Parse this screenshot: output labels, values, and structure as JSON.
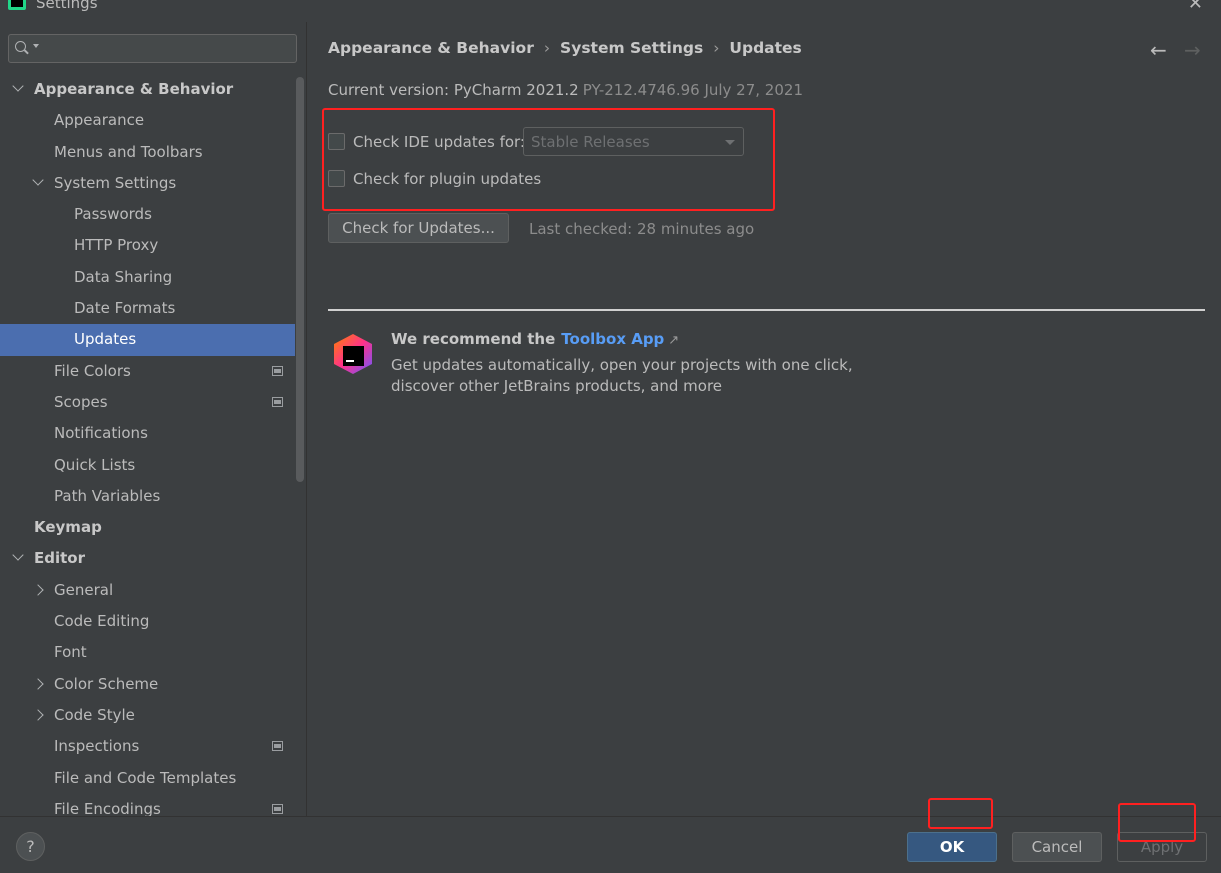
{
  "window": {
    "title": "Settings",
    "close_glyph": "✕"
  },
  "sidebar": {
    "search": {
      "value": "",
      "placeholder": ""
    },
    "items": [
      {
        "label": "Appearance & Behavior",
        "level": 0,
        "bold": true,
        "expander": "down"
      },
      {
        "label": "Appearance",
        "level": 1
      },
      {
        "label": "Menus and Toolbars",
        "level": 1
      },
      {
        "label": "System Settings",
        "level": 1,
        "expander": "down"
      },
      {
        "label": "Passwords",
        "level": 2
      },
      {
        "label": "HTTP Proxy",
        "level": 2
      },
      {
        "label": "Data Sharing",
        "level": 2
      },
      {
        "label": "Date Formats",
        "level": 2
      },
      {
        "label": "Updates",
        "level": 2,
        "selected": true
      },
      {
        "label": "File Colors",
        "level": 1,
        "page_icon": true
      },
      {
        "label": "Scopes",
        "level": 1,
        "page_icon": true
      },
      {
        "label": "Notifications",
        "level": 1
      },
      {
        "label": "Quick Lists",
        "level": 1
      },
      {
        "label": "Path Variables",
        "level": 1
      },
      {
        "label": "Keymap",
        "level": 0,
        "bold": true
      },
      {
        "label": "Editor",
        "level": 0,
        "bold": true,
        "expander": "down"
      },
      {
        "label": "General",
        "level": 1,
        "expander": "right"
      },
      {
        "label": "Code Editing",
        "level": 1
      },
      {
        "label": "Font",
        "level": 1
      },
      {
        "label": "Color Scheme",
        "level": 1,
        "expander": "right"
      },
      {
        "label": "Code Style",
        "level": 1,
        "expander": "right"
      },
      {
        "label": "Inspections",
        "level": 1,
        "page_icon": true
      },
      {
        "label": "File and Code Templates",
        "level": 1
      },
      {
        "label": "File Encodings",
        "level": 1,
        "page_icon": true
      }
    ]
  },
  "main": {
    "breadcrumb": [
      "Appearance & Behavior",
      "System Settings",
      "Updates"
    ],
    "breadcrumb_sep": "›",
    "nav_back": "←",
    "nav_forward": "→",
    "version_label": "Current version: PyCharm 2021.2",
    "version_build": "PY-212.4746.96 July 27, 2021",
    "check_ide_updates": {
      "label": "Check IDE updates for:",
      "checked": false
    },
    "channel_combo": {
      "value": "Stable Releases"
    },
    "check_plugin_updates": {
      "label": "Check for plugin updates",
      "checked": false
    },
    "check_now_button": "Check for Updates...",
    "last_checked": "Last checked: 28 minutes ago",
    "toolbox": {
      "title_prefix": "We recommend the",
      "link_text": "Toolbox App",
      "link_arrow": "↗",
      "desc_line1": "Get updates automatically, open your projects with one click,",
      "desc_line2": "discover other JetBrains products, and more"
    }
  },
  "footer": {
    "help_label": "?",
    "ok_label": "OK",
    "cancel_label": "Cancel",
    "apply_label": "Apply"
  },
  "colors": {
    "background": "#3c3f41",
    "selection": "#4b6eaf",
    "link": "#589df6",
    "highlight_annotation": "#ff2020",
    "ok_button": "#365880"
  }
}
